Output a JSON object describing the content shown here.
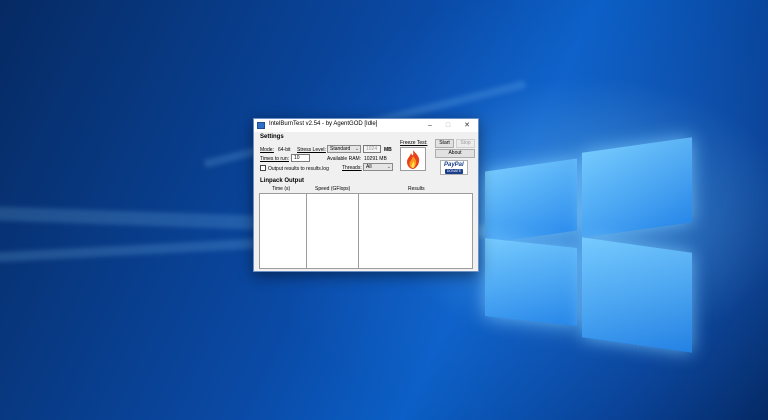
{
  "window": {
    "title": "IntelBurnTest v2.54 - by AgentGOD [Idle]",
    "minimize_glyph": "–",
    "maximize_glyph": "□",
    "close_glyph": "✕"
  },
  "settings": {
    "group_label": "Settings",
    "mode_label": "Mode:",
    "mode_value": "64-bit",
    "stress_label": "Stress Level:",
    "stress_value": "Standard",
    "memory_value": "1024",
    "memory_unit": "MB",
    "times_label": "Times to run:",
    "times_value": "10",
    "ram_label": "Available RAM:",
    "ram_value": "10291 MB",
    "output_log_label": "Output results to results.log",
    "output_log_checked": false,
    "threads_label": "Threads:",
    "threads_value": "All",
    "freeze_label": "Freeze Test:",
    "start_label": "Start",
    "stop_label": "Stop",
    "about_label": "About",
    "paypal_label": "PayPal",
    "donate_label": "DONATE"
  },
  "linpack": {
    "group_label": "Linpack Output",
    "columns": [
      "Time (s)",
      "Speed (GFlops)",
      "Results"
    ]
  },
  "icons": {
    "app_icon": "intelburntest-app-icon",
    "freeze_icon": "flame-icon",
    "paypal_icon": "paypal-donate-icon"
  },
  "colors": {
    "desktop_bg": "#0a4aa6",
    "window_bg": "#f0f0f0",
    "paypal_blue": "#1a3e8c"
  }
}
